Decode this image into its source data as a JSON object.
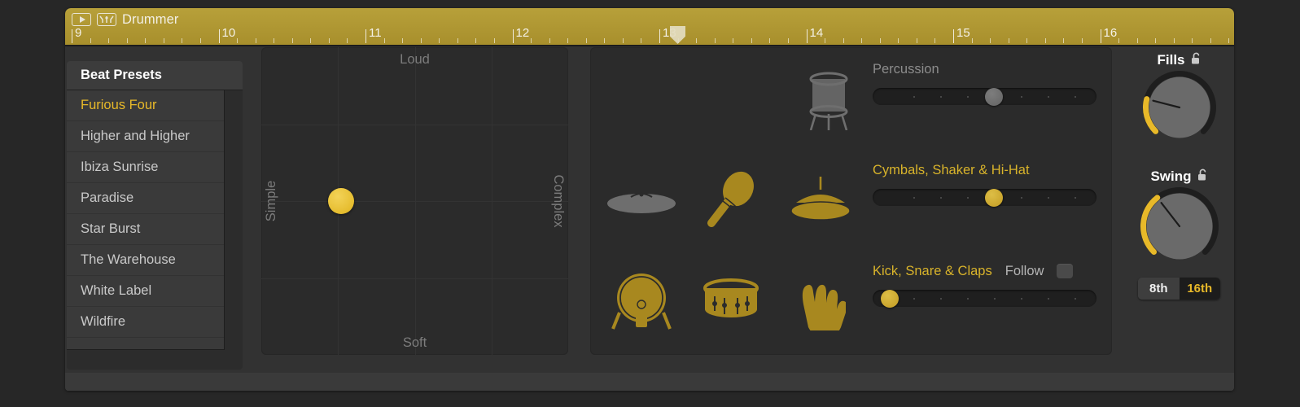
{
  "window": {
    "title": "Drummer",
    "play_icon": "play-icon",
    "drummer_icon": "drummer-editor-icon"
  },
  "ruler": {
    "bars": [
      "9",
      "10",
      "11",
      "12",
      "13",
      "14",
      "15",
      "16"
    ],
    "playhead_bar": "13"
  },
  "presets": {
    "header": "Beat Presets",
    "selected": "Furious Four",
    "items": [
      "Furious Four",
      "Higher and Higher",
      "Ibiza Sunrise",
      "Paradise",
      "Star Burst",
      "The Warehouse",
      "White Label",
      "Wildfire"
    ]
  },
  "xy_pad": {
    "label_top": "Loud",
    "label_bottom": "Soft",
    "label_left": "Simple",
    "label_right": "Complex",
    "puck_x_pct": 26,
    "puck_y_pct": 50,
    "puck_color": "#e6bd2f"
  },
  "instruments": {
    "rows": [
      {
        "name": "percussion",
        "label": "Percussion",
        "active": false,
        "slider_value_pct": 58,
        "icons": [
          {
            "name": "tom-drum-icon",
            "active": false
          }
        ],
        "has_follow": false
      },
      {
        "name": "cymbals",
        "label": "Cymbals, Shaker & Hi-Hat",
        "active": true,
        "slider_value_pct": 58,
        "icons": [
          {
            "name": "crash-cymbal-icon",
            "active": false
          },
          {
            "name": "shaker-maraca-icon",
            "active": true
          },
          {
            "name": "hi-hat-icon",
            "active": true
          }
        ],
        "has_follow": false
      },
      {
        "name": "kick-snare",
        "label": "Kick, Snare & Claps",
        "active": true,
        "slider_value_pct": 4,
        "icons": [
          {
            "name": "kick-drum-icon",
            "active": true
          },
          {
            "name": "snare-drum-icon",
            "active": true
          },
          {
            "name": "clap-hand-icon",
            "active": true
          }
        ],
        "has_follow": true,
        "follow_label": "Follow",
        "follow_checked": false
      }
    ]
  },
  "controls": {
    "fills": {
      "label": "Fills",
      "lock_icon": "unlocked-padlock-icon",
      "value_pct": 22,
      "arc_color": "#e8b929"
    },
    "swing": {
      "label": "Swing",
      "lock_icon": "unlocked-padlock-icon",
      "value_pct": 36,
      "arc_color": "#e8b929"
    },
    "note_division": {
      "options": [
        "8th",
        "16th"
      ],
      "selected": "16th"
    }
  },
  "colors": {
    "accent": "#e8b929",
    "ruler": "#b7a03a",
    "panel": "#2b2b2b",
    "window": "#323232"
  }
}
